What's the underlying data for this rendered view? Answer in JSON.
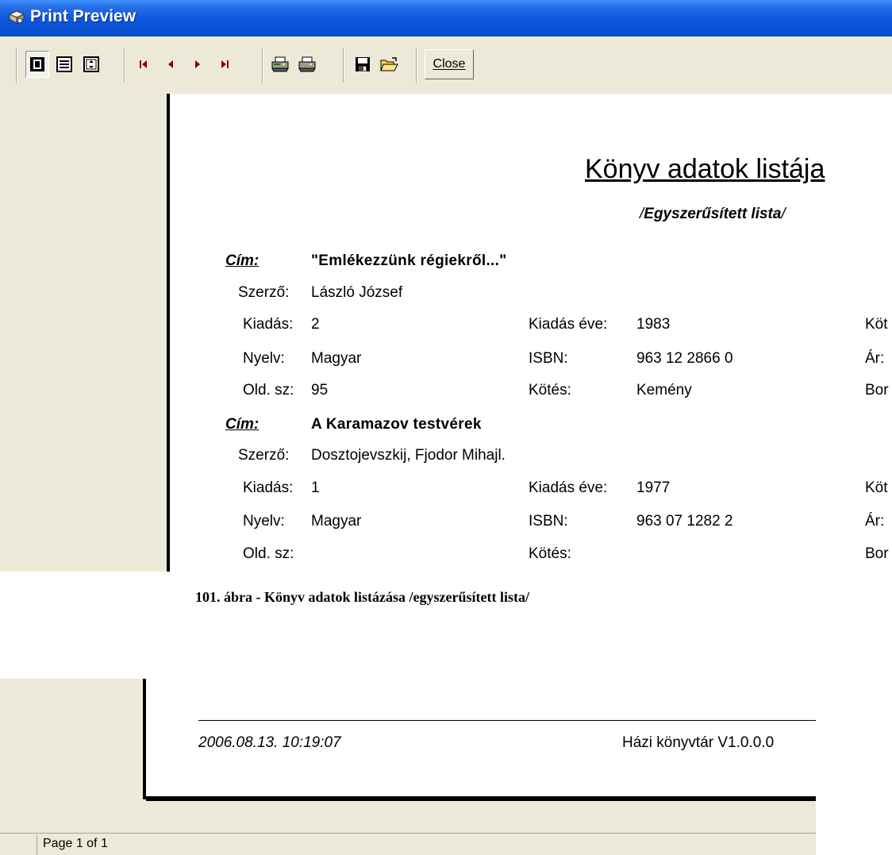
{
  "window": {
    "title": "Print Preview"
  },
  "toolbar": {
    "buttons": [
      "one-page",
      "page-width",
      "fit-page",
      "first-page",
      "previous-page",
      "next-page",
      "last-page",
      "print-setup",
      "print",
      "save",
      "open"
    ],
    "close_label": "Close"
  },
  "report": {
    "title": "Könyv adatok listája",
    "subtitle_prefix": "/",
    "subtitle_main": "Egyszerűsített lista",
    "subtitle_suffix": "/",
    "books": [
      {
        "cim_label": "Cím:",
        "cim": "\"Emlékezzünk régiekről...\"",
        "szerzo_label": "Szerző:",
        "szerzo": "László József",
        "kiadas_label": "Kiadás:",
        "kiadas": "2",
        "kiadas_eve_label": "Kiadás éve:",
        "kiadas_eve": "1983",
        "col3_row1": "Köt",
        "nyelv_label": "Nyelv:",
        "nyelv": "Magyar",
        "isbn_label": "ISBN:",
        "isbn": "963 12 2866 0",
        "col3_row2": "Ár:",
        "old_label": "Old. sz:",
        "old": "95",
        "kotes_label": "Kötés:",
        "kotes": "Kemény",
        "col3_row3": "Bor"
      },
      {
        "cim_label": "Cím:",
        "cim": "A Karamazov testvérek",
        "szerzo_label": "Szerző:",
        "szerzo": "Dosztojevszkij, Fjodor Mihajl.",
        "kiadas_label": "Kiadás:",
        "kiadas": "1",
        "kiadas_eve_label": "Kiadás éve:",
        "kiadas_eve": "1977",
        "col3_row1": "Köt",
        "nyelv_label": "Nyelv:",
        "nyelv": "Magyar",
        "isbn_label": "ISBN:",
        "isbn": "963 07 1282 2",
        "col3_row2": "Ár:",
        "old_label": "Old. sz:",
        "old": "",
        "kotes_label": "Kötés:",
        "kotes": "",
        "col3_row3": "Bor"
      }
    ]
  },
  "caption": "101. ábra - Könyv adatok listázása /egyszerűsített lista/",
  "footer": {
    "datetime": "2006.08.13. 10:19:07",
    "app": "Házi könyvtár V1.0.0.0"
  },
  "statusbar": {
    "text": "Page 1 of 1"
  }
}
